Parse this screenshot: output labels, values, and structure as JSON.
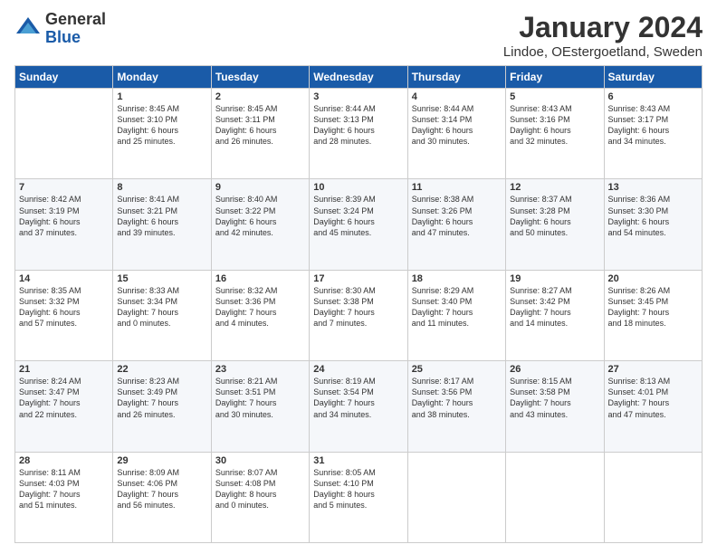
{
  "logo": {
    "general": "General",
    "blue": "Blue"
  },
  "title": "January 2024",
  "location": "Lindoe, OEstergoetland, Sweden",
  "weekdays": [
    "Sunday",
    "Monday",
    "Tuesday",
    "Wednesday",
    "Thursday",
    "Friday",
    "Saturday"
  ],
  "weeks": [
    [
      {
        "day": "",
        "sunrise": "",
        "sunset": "",
        "daylight": ""
      },
      {
        "day": "1",
        "sunrise": "Sunrise: 8:45 AM",
        "sunset": "Sunset: 3:10 PM",
        "daylight": "Daylight: 6 hours and 25 minutes."
      },
      {
        "day": "2",
        "sunrise": "Sunrise: 8:45 AM",
        "sunset": "Sunset: 3:11 PM",
        "daylight": "Daylight: 6 hours and 26 minutes."
      },
      {
        "day": "3",
        "sunrise": "Sunrise: 8:44 AM",
        "sunset": "Sunset: 3:13 PM",
        "daylight": "Daylight: 6 hours and 28 minutes."
      },
      {
        "day": "4",
        "sunrise": "Sunrise: 8:44 AM",
        "sunset": "Sunset: 3:14 PM",
        "daylight": "Daylight: 6 hours and 30 minutes."
      },
      {
        "day": "5",
        "sunrise": "Sunrise: 8:43 AM",
        "sunset": "Sunset: 3:16 PM",
        "daylight": "Daylight: 6 hours and 32 minutes."
      },
      {
        "day": "6",
        "sunrise": "Sunrise: 8:43 AM",
        "sunset": "Sunset: 3:17 PM",
        "daylight": "Daylight: 6 hours and 34 minutes."
      }
    ],
    [
      {
        "day": "7",
        "sunrise": "Sunrise: 8:42 AM",
        "sunset": "Sunset: 3:19 PM",
        "daylight": "Daylight: 6 hours and 37 minutes."
      },
      {
        "day": "8",
        "sunrise": "Sunrise: 8:41 AM",
        "sunset": "Sunset: 3:21 PM",
        "daylight": "Daylight: 6 hours and 39 minutes."
      },
      {
        "day": "9",
        "sunrise": "Sunrise: 8:40 AM",
        "sunset": "Sunset: 3:22 PM",
        "daylight": "Daylight: 6 hours and 42 minutes."
      },
      {
        "day": "10",
        "sunrise": "Sunrise: 8:39 AM",
        "sunset": "Sunset: 3:24 PM",
        "daylight": "Daylight: 6 hours and 45 minutes."
      },
      {
        "day": "11",
        "sunrise": "Sunrise: 8:38 AM",
        "sunset": "Sunset: 3:26 PM",
        "daylight": "Daylight: 6 hours and 47 minutes."
      },
      {
        "day": "12",
        "sunrise": "Sunrise: 8:37 AM",
        "sunset": "Sunset: 3:28 PM",
        "daylight": "Daylight: 6 hours and 50 minutes."
      },
      {
        "day": "13",
        "sunrise": "Sunrise: 8:36 AM",
        "sunset": "Sunset: 3:30 PM",
        "daylight": "Daylight: 6 hours and 54 minutes."
      }
    ],
    [
      {
        "day": "14",
        "sunrise": "Sunrise: 8:35 AM",
        "sunset": "Sunset: 3:32 PM",
        "daylight": "Daylight: 6 hours and 57 minutes."
      },
      {
        "day": "15",
        "sunrise": "Sunrise: 8:33 AM",
        "sunset": "Sunset: 3:34 PM",
        "daylight": "Daylight: 7 hours and 0 minutes."
      },
      {
        "day": "16",
        "sunrise": "Sunrise: 8:32 AM",
        "sunset": "Sunset: 3:36 PM",
        "daylight": "Daylight: 7 hours and 4 minutes."
      },
      {
        "day": "17",
        "sunrise": "Sunrise: 8:30 AM",
        "sunset": "Sunset: 3:38 PM",
        "daylight": "Daylight: 7 hours and 7 minutes."
      },
      {
        "day": "18",
        "sunrise": "Sunrise: 8:29 AM",
        "sunset": "Sunset: 3:40 PM",
        "daylight": "Daylight: 7 hours and 11 minutes."
      },
      {
        "day": "19",
        "sunrise": "Sunrise: 8:27 AM",
        "sunset": "Sunset: 3:42 PM",
        "daylight": "Daylight: 7 hours and 14 minutes."
      },
      {
        "day": "20",
        "sunrise": "Sunrise: 8:26 AM",
        "sunset": "Sunset: 3:45 PM",
        "daylight": "Daylight: 7 hours and 18 minutes."
      }
    ],
    [
      {
        "day": "21",
        "sunrise": "Sunrise: 8:24 AM",
        "sunset": "Sunset: 3:47 PM",
        "daylight": "Daylight: 7 hours and 22 minutes."
      },
      {
        "day": "22",
        "sunrise": "Sunrise: 8:23 AM",
        "sunset": "Sunset: 3:49 PM",
        "daylight": "Daylight: 7 hours and 26 minutes."
      },
      {
        "day": "23",
        "sunrise": "Sunrise: 8:21 AM",
        "sunset": "Sunset: 3:51 PM",
        "daylight": "Daylight: 7 hours and 30 minutes."
      },
      {
        "day": "24",
        "sunrise": "Sunrise: 8:19 AM",
        "sunset": "Sunset: 3:54 PM",
        "daylight": "Daylight: 7 hours and 34 minutes."
      },
      {
        "day": "25",
        "sunrise": "Sunrise: 8:17 AM",
        "sunset": "Sunset: 3:56 PM",
        "daylight": "Daylight: 7 hours and 38 minutes."
      },
      {
        "day": "26",
        "sunrise": "Sunrise: 8:15 AM",
        "sunset": "Sunset: 3:58 PM",
        "daylight": "Daylight: 7 hours and 43 minutes."
      },
      {
        "day": "27",
        "sunrise": "Sunrise: 8:13 AM",
        "sunset": "Sunset: 4:01 PM",
        "daylight": "Daylight: 7 hours and 47 minutes."
      }
    ],
    [
      {
        "day": "28",
        "sunrise": "Sunrise: 8:11 AM",
        "sunset": "Sunset: 4:03 PM",
        "daylight": "Daylight: 7 hours and 51 minutes."
      },
      {
        "day": "29",
        "sunrise": "Sunrise: 8:09 AM",
        "sunset": "Sunset: 4:06 PM",
        "daylight": "Daylight: 7 hours and 56 minutes."
      },
      {
        "day": "30",
        "sunrise": "Sunrise: 8:07 AM",
        "sunset": "Sunset: 4:08 PM",
        "daylight": "Daylight: 8 hours and 0 minutes."
      },
      {
        "day": "31",
        "sunrise": "Sunrise: 8:05 AM",
        "sunset": "Sunset: 4:10 PM",
        "daylight": "Daylight: 8 hours and 5 minutes."
      },
      {
        "day": "",
        "sunrise": "",
        "sunset": "",
        "daylight": ""
      },
      {
        "day": "",
        "sunrise": "",
        "sunset": "",
        "daylight": ""
      },
      {
        "day": "",
        "sunrise": "",
        "sunset": "",
        "daylight": ""
      }
    ]
  ]
}
